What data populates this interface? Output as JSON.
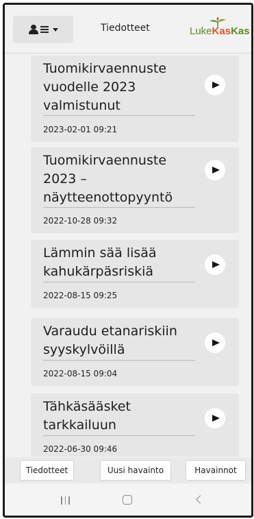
{
  "header": {
    "title": "Tiedotteet",
    "logo": {
      "luke": "Luke",
      "kas1": "Kas",
      "kas2": "Kas"
    },
    "menu_icons": [
      "user-icon",
      "list-icon",
      "caret-down-icon"
    ]
  },
  "announcements": [
    {
      "title": "Tuomikirvaennuste vuodelle 2023 valmistunut",
      "date": "2023-02-01 09:21"
    },
    {
      "title": "Tuomikirvaennuste 2023 – näytteenottopyyntö",
      "date": "2022-10-28 09:32"
    },
    {
      "title": "Lämmin sää lisää kahukärpäsriskiä",
      "date": "2022-08-15 09:25"
    },
    {
      "title": "Varaudu etanariskiin syyskylvöillä",
      "date": "2022-08-15 09:04"
    },
    {
      "title": "Tähkäsääsket tarkkailuun",
      "date": "2022-06-30 09:46"
    }
  ],
  "bottom_tabs": {
    "notices": "Tiedotteet",
    "new_observation": "Uusi havainto",
    "observations": "Havainnot"
  },
  "colors": {
    "brand_green": "#5e8a2a",
    "brand_orange": "#e5532a",
    "card_background": "#e6e6e6"
  }
}
